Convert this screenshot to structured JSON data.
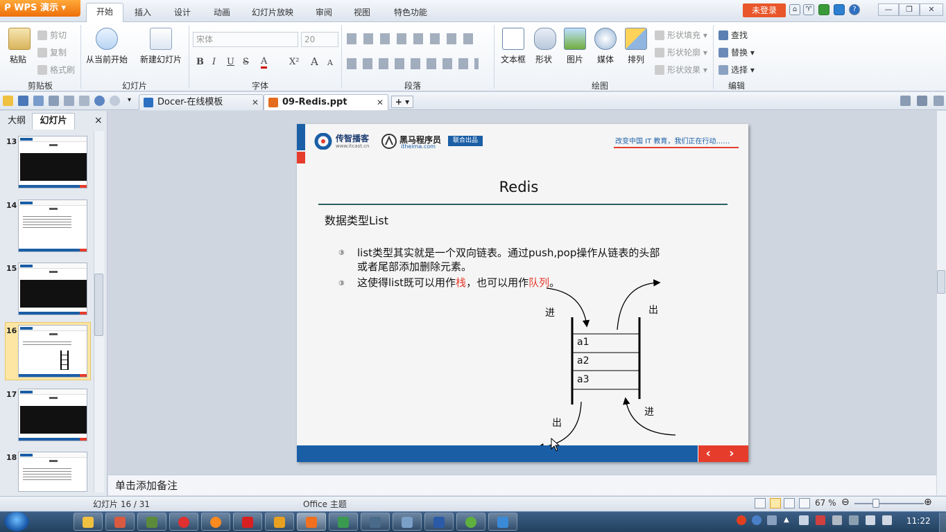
{
  "app": {
    "logo_text": "WPS 演示",
    "login_label": "未登录"
  },
  "menu": {
    "tabs": [
      "开始",
      "插入",
      "设计",
      "动画",
      "幻灯片放映",
      "审阅",
      "视图",
      "特色功能"
    ]
  },
  "ribbon": {
    "clipboard": {
      "paste": "粘贴",
      "cut": "剪切",
      "copy": "复制",
      "format_painter": "格式刷",
      "group": "剪贴板"
    },
    "slides": {
      "from_current": "从当前开始",
      "new_slide": "新建幻灯片",
      "group": "幻灯片"
    },
    "font": {
      "font_name": "宋体",
      "font_size": "20",
      "group": "字体",
      "bold": "B",
      "italic": "I",
      "underline": "U",
      "strike": "S",
      "color": "A",
      "superscript": "X²",
      "grow": "A",
      "shrink": "A"
    },
    "paragraph": {
      "group": "段落"
    },
    "drawing": {
      "textbox": "文本框",
      "shape": "形状",
      "picture": "图片",
      "media": "媒体",
      "arrange": "排列",
      "shape_fill": "形状填充",
      "shape_outline": "形状轮廓",
      "shape_effect": "形状效果",
      "group": "绘图"
    },
    "edit": {
      "find": "查找",
      "replace": "替换",
      "select": "选择",
      "group": "编辑"
    }
  },
  "doc_tabs": [
    {
      "label": "Docer-在线模板"
    },
    {
      "label": "09-Redis.ppt"
    }
  ],
  "panel": {
    "outline_tab": "大纲",
    "slides_tab": "幻灯片",
    "close": "×",
    "thumbnails": [
      "13",
      "14",
      "15",
      "16",
      "17",
      "18"
    ],
    "selected": "16"
  },
  "slide": {
    "logo1": "传智播客",
    "logo1_sub": "www.itcast.cn",
    "logo2": "黑马程序员",
    "logo2_sub": "itheima.com",
    "joint": "联合出品",
    "slogan": "改变中国 IT 教育，我们正在行动……",
    "title": "Redis",
    "subtitle": "数据类型List",
    "bullet_mark": "③",
    "bullet1_line1": "list类型其实就是一个双向链表。通过push,pop操作从链表的头部",
    "bullet1_line2": "或者尾部添加删除元素。",
    "bullet2_pre": "这使得list既可以用作",
    "bullet2_stack": "栈",
    "bullet2_mid": "，也可以用作",
    "bullet2_queue": "队列",
    "bullet2_end": "。",
    "diagram": {
      "in_top": "进",
      "out_top": "出",
      "items": [
        "a1",
        "a2",
        "a3"
      ],
      "out_bottom": "出",
      "in_bottom": "进"
    },
    "footer_nav": "‹ ›"
  },
  "notes_placeholder": "单击添加备注",
  "status": {
    "slide_counter": "幻灯片 16 / 31",
    "theme": "Office 主题",
    "zoom": "67 %"
  },
  "taskbar": {
    "clock": "11:22"
  }
}
